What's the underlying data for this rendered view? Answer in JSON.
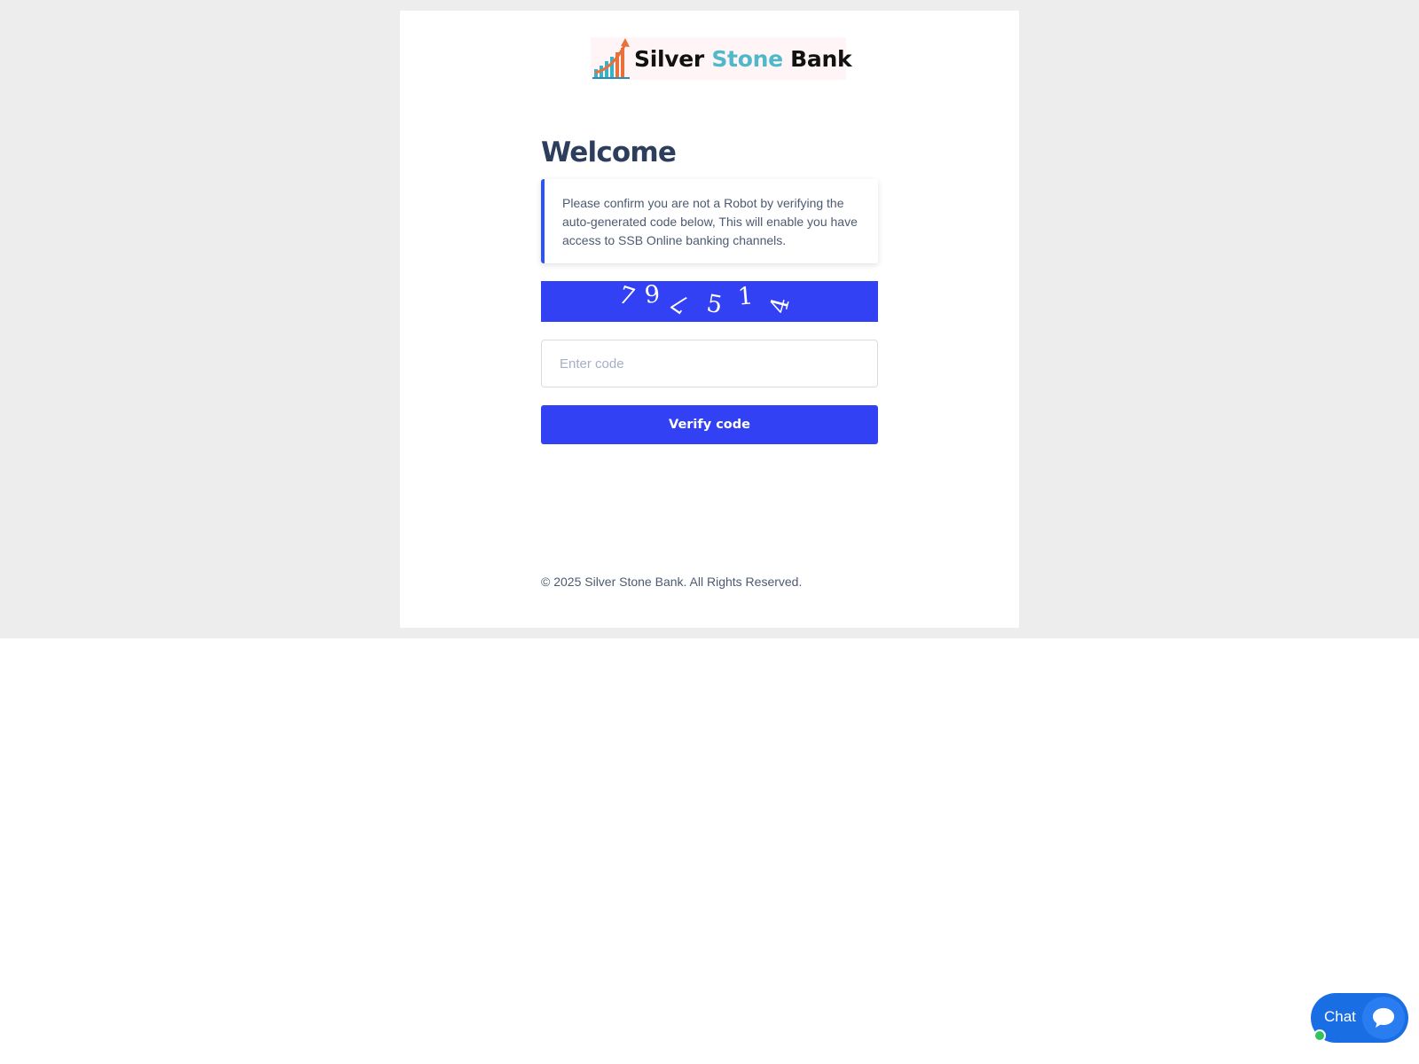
{
  "brand": {
    "name_part1": "Silver",
    "name_part2": "Stone",
    "name_part3": "Bank"
  },
  "main": {
    "title": "Welcome",
    "notice": "Please confirm you are not a Robot by verifying the auto-generated code below, This will enable you have access to SSB Online banking channels.",
    "captcha_chars": [
      "7",
      "9",
      "7",
      "5",
      "1",
      "4"
    ],
    "code_input": {
      "value": "",
      "placeholder": "Enter code"
    },
    "verify_label": "Verify code"
  },
  "footer": {
    "copyright": "© 2025 Silver Stone Bank. All Rights Reserved."
  },
  "chat": {
    "label": "Chat"
  },
  "colors": {
    "accent": "#3341f5",
    "notice_border": "#3155e6",
    "title": "#2c3e5c",
    "brand_teal": "#4fb9c9",
    "chat": "#1a6ee3",
    "online": "#32c45c"
  },
  "icons": {
    "logo": "rising-bar-chart-logo",
    "chat": "chat-bubble-icon",
    "status": "online-status-dot"
  }
}
